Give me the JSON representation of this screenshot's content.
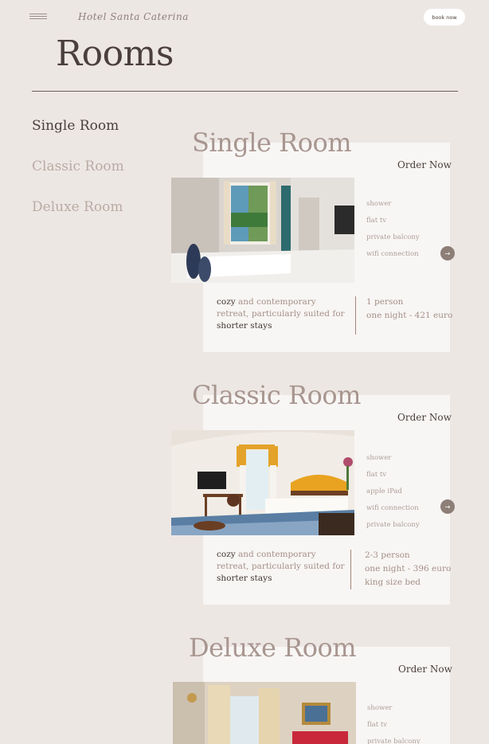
{
  "header": {
    "brand": "Hotel Santa Caterina",
    "book_label": "book now"
  },
  "page": {
    "title": "Rooms"
  },
  "sidenav": {
    "items": [
      {
        "label": "Single Room"
      },
      {
        "label": "Classic Room"
      },
      {
        "label": "Deluxe Room"
      }
    ]
  },
  "rooms": [
    {
      "title": "Single Room",
      "order_label": "Order Now",
      "amenities": [
        "shower",
        "flat tv",
        "private balcony",
        "wifi connection"
      ],
      "arrow": "→",
      "desc": {
        "w1": "cozy",
        "w2": " and contemporary retreat, particularly suited for ",
        "w3": "shorter",
        "w4": " stays"
      },
      "specs": [
        "1 person",
        "one night - 421 euro"
      ]
    },
    {
      "title": "Classic Room",
      "order_label": "Order Now",
      "amenities": [
        "shower",
        "flat tv",
        "apple iPad",
        "wifi connection",
        "private balcony"
      ],
      "arrow": "→",
      "desc": {
        "w1": "cozy",
        "w2": " and contemporary retreat, particularly suited for ",
        "w3": "shorter",
        "w4": " stays"
      },
      "specs": [
        "2-3 person",
        "one night - 396 euro",
        "king size bed"
      ]
    },
    {
      "title": "Deluxe Room",
      "order_label": "Order Now",
      "amenities": [
        "shower",
        "flat tv",
        "private balcony"
      ]
    }
  ]
}
